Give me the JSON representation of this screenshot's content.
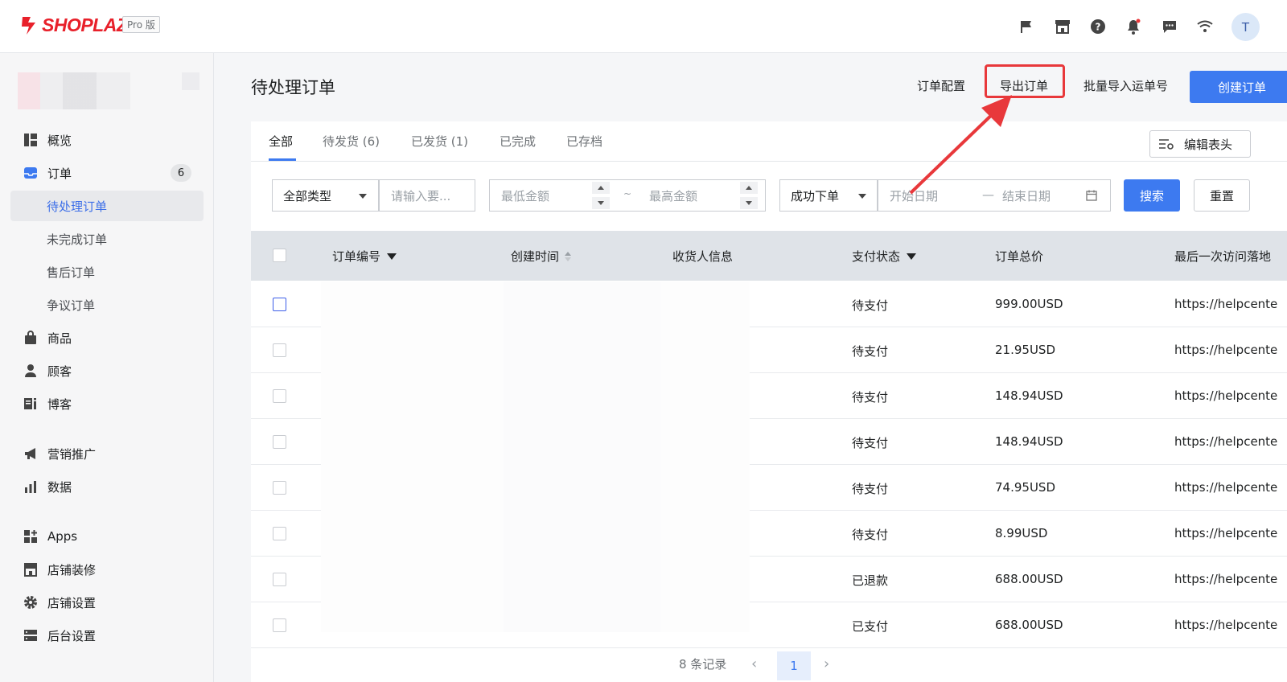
{
  "brand": {
    "name": "SHOPLAZZA",
    "edition": "Pro 版",
    "accent": "#3d7af0",
    "logo_color": "#e8202a"
  },
  "topbar": {
    "icons": [
      "flag-icon",
      "store-icon",
      "help-icon",
      "bell-icon",
      "chat-icon",
      "wifi-icon"
    ],
    "avatar_letter": "T"
  },
  "sidebar": {
    "items": [
      {
        "label": "概览",
        "icon": "overview-icon"
      },
      {
        "label": "订单",
        "icon": "inbox-icon",
        "badge": "6"
      },
      {
        "label": "待处理订单",
        "sub": true,
        "active": true
      },
      {
        "label": "未完成订单",
        "sub": true
      },
      {
        "label": "售后订单",
        "sub": true
      },
      {
        "label": "争议订单",
        "sub": true
      },
      {
        "label": "商品",
        "icon": "bag-icon"
      },
      {
        "label": "顾客",
        "icon": "person-icon"
      },
      {
        "label": "博客",
        "icon": "blog-icon"
      },
      {
        "label": "营销推广",
        "icon": "megaphone-icon"
      },
      {
        "label": "数据",
        "icon": "bar-chart-icon"
      },
      {
        "label": "Apps",
        "icon": "apps-icon"
      },
      {
        "label": "店铺装修",
        "icon": "storefront-icon"
      },
      {
        "label": "店铺设置",
        "icon": "gear-icon"
      },
      {
        "label": "后台设置",
        "icon": "server-icon"
      }
    ]
  },
  "header": {
    "title": "待处理订单",
    "order_config": "订单配置",
    "export_orders": "导出订单",
    "bulk_import": "批量导入运单号",
    "create_order": "创建订单"
  },
  "tabs": [
    "全部",
    "待发货 (6)",
    "已发货 (1)",
    "已完成",
    "已存档"
  ],
  "edit_header_label": "编辑表头",
  "filters": {
    "type_select": "全部类型",
    "keyword_placeholder": "请输入要...",
    "min_amount_placeholder": "最低金额",
    "range_sep": "~",
    "max_amount_placeholder": "最高金额",
    "time_type_select": "成功下单",
    "start_date_placeholder": "开始日期",
    "date_sep": "—",
    "end_date_placeholder": "结束日期",
    "search_label": "搜索",
    "reset_label": "重置"
  },
  "table": {
    "columns": [
      "订单编号",
      "创建时间",
      "收货人信息",
      "支付状态",
      "订单总价",
      "最后一次访问落地"
    ],
    "rows": [
      {
        "status": "待支付",
        "total": "999.00USD",
        "landing": "https://helpcente"
      },
      {
        "status": "待支付",
        "total": "21.95USD",
        "landing": "https://helpcente"
      },
      {
        "status": "待支付",
        "total": "148.94USD",
        "landing": "https://helpcente"
      },
      {
        "status": "待支付",
        "total": "148.94USD",
        "landing": "https://helpcente"
      },
      {
        "status": "待支付",
        "total": "74.95USD",
        "landing": "https://helpcente"
      },
      {
        "status": "待支付",
        "total": "8.99USD",
        "landing": "https://helpcente"
      },
      {
        "status": "已退款",
        "total": "688.00USD",
        "landing": "https://helpcente"
      },
      {
        "status": "已支付",
        "total": "688.00USD",
        "landing": "https://helpcente"
      }
    ]
  },
  "pagination": {
    "count_label": "8 条记录",
    "current_page": "1"
  }
}
